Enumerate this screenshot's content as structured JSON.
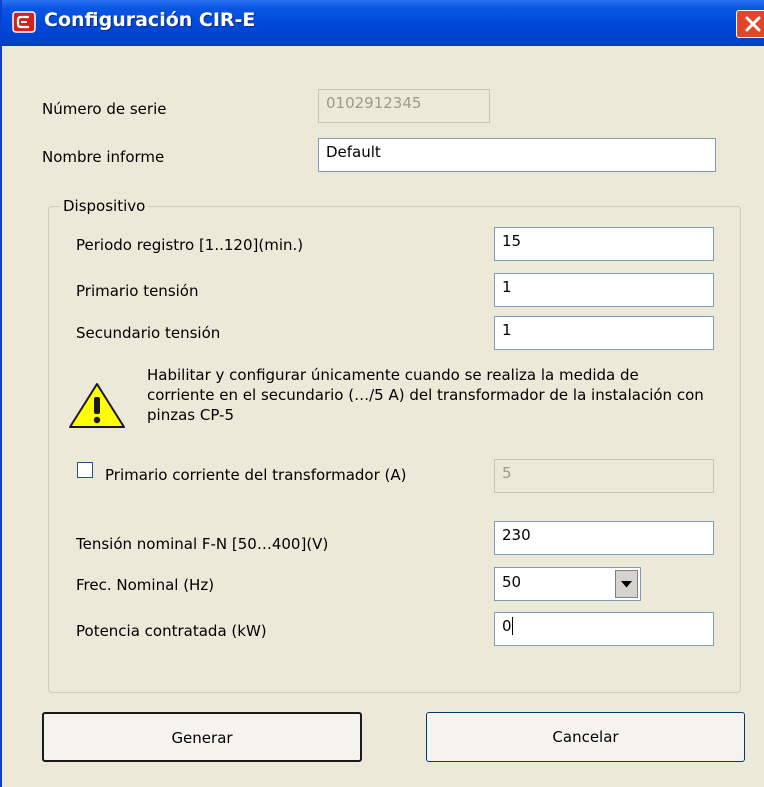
{
  "window": {
    "title": "Configuración CIR-E"
  },
  "serial": {
    "label": "Número de serie",
    "value": "0102912345"
  },
  "report_name": {
    "label": "Nombre informe",
    "value": "Default"
  },
  "device": {
    "legend": "Dispositivo",
    "period": {
      "label": "Periodo registro [1..120](min.)",
      "value": "15"
    },
    "primary_voltage": {
      "label": "Primario tensión",
      "value": "1"
    },
    "secondary_voltage": {
      "label": "Secundario tensión",
      "value": "1"
    },
    "warning_text": "Habilitar y configurar únicamente cuando se realiza la medida de corriente en el secundario (…/5 A) del transformador de la instalación con pinzas CP-5",
    "primary_current": {
      "label": "Primario corriente del transformador (A)",
      "value": "5",
      "checked": false
    },
    "nominal_voltage": {
      "label": "Tensión nominal  F-N [50…400](V)",
      "value": "230"
    },
    "nominal_freq": {
      "label": "Frec. Nominal (Hz)",
      "selected": "50"
    },
    "contracted_power": {
      "label": "Potencia contratada (kW)",
      "value": "0"
    }
  },
  "buttons": {
    "generate": "Generar",
    "cancel": "Cancelar"
  },
  "icons": {
    "app": "app-logo-icon",
    "close": "close-icon",
    "warning": "warning-icon",
    "dropdown": "chevron-down-icon"
  },
  "colors": {
    "titlebar": "#0048d8",
    "close": "#e2462a",
    "dialog_bg": "#ece9d8",
    "warning_yellow": "#ffff00"
  }
}
